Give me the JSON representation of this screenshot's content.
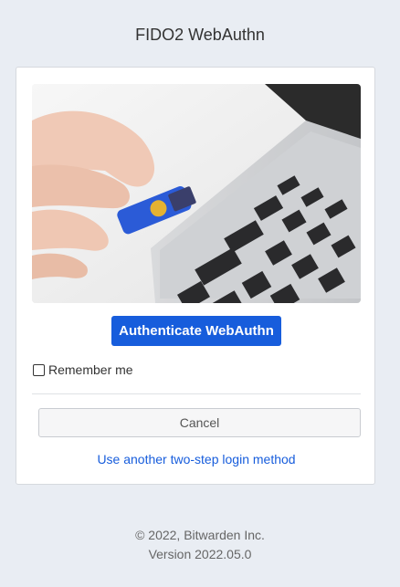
{
  "header": {
    "title": "FIDO2 WebAuthn"
  },
  "card": {
    "authenticate_label": "Authenticate WebAuthn",
    "remember_label": "Remember me",
    "remember_checked": false,
    "cancel_label": "Cancel",
    "alt_method_label": "Use another two-step login method",
    "accent_color": "#175ddc"
  },
  "footer": {
    "copyright": "© 2022, Bitwarden Inc.",
    "version": "Version 2022.05.0"
  }
}
